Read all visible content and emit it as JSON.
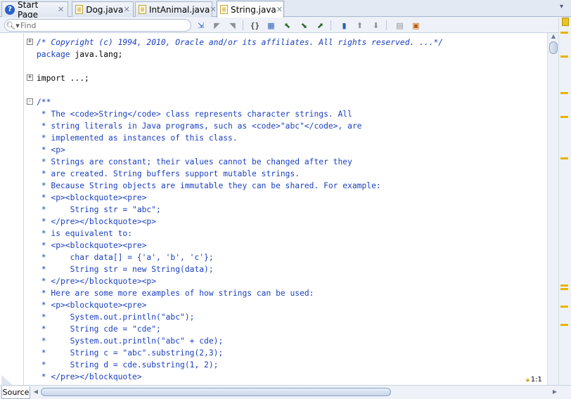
{
  "tabs": [
    {
      "label": "Start Page",
      "icon": "help-icon",
      "close": "✕",
      "active": false
    },
    {
      "label": "Dog.java",
      "icon": "java-file-icon",
      "close": "✕",
      "active": false
    },
    {
      "label": "IntAnimal.java",
      "icon": "java-file-icon",
      "close": "✕",
      "active": false
    },
    {
      "label": "String.java",
      "icon": "java-file-icon",
      "close": "✕",
      "active": true
    }
  ],
  "tabbar_menu": "▾",
  "find": {
    "placeholder": "Find"
  },
  "toolbar_icons": [
    "last-edit-icon",
    "back-icon",
    "forward-icon",
    "toggle-bookmark-icon",
    "find-selection-icon",
    "find-previous-icon",
    "find-next-icon",
    "toggle-highlight-icon",
    "toggle-rectangular-selection-icon",
    "previous-bookmark-icon",
    "next-bookmark-icon",
    "start-macro-icon",
    "stop-macro-icon",
    "shift-left-icon",
    "shift-right-icon"
  ],
  "code_lines": [
    {
      "fold": "+",
      "text": "/* Copyright (c) 1994, 2010, Oracle and/or its affiliates. All rights reserved. ...*/",
      "style": "italic"
    },
    {
      "fold": "",
      "text": "package java.lang;",
      "style": "package"
    },
    {
      "fold": "",
      "text": "",
      "style": "black"
    },
    {
      "fold": "+",
      "text": "import ...;",
      "style": "black"
    },
    {
      "fold": "",
      "text": "",
      "style": "black"
    },
    {
      "fold": "-",
      "text": "/**",
      "style": "comment"
    },
    {
      "fold": "",
      "text": " * The <code>String</code> class represents character strings. All",
      "style": "comment"
    },
    {
      "fold": "",
      "text": " * string literals in Java programs, such as <code>\"abc\"</code>, are",
      "style": "comment"
    },
    {
      "fold": "",
      "text": " * implemented as instances of this class.",
      "style": "comment"
    },
    {
      "fold": "",
      "text": " * <p>",
      "style": "comment"
    },
    {
      "fold": "",
      "text": " * Strings are constant; their values cannot be changed after they",
      "style": "comment"
    },
    {
      "fold": "",
      "text": " * are created. String buffers support mutable strings.",
      "style": "comment"
    },
    {
      "fold": "",
      "text": " * Because String objects are immutable they can be shared. For example:",
      "style": "comment"
    },
    {
      "fold": "",
      "text": " * <p><blockquote><pre>",
      "style": "comment"
    },
    {
      "fold": "",
      "text": " *     String str = \"abc\";",
      "style": "comment"
    },
    {
      "fold": "",
      "text": " * </pre></blockquote><p>",
      "style": "comment"
    },
    {
      "fold": "",
      "text": " * is equivalent to:",
      "style": "comment"
    },
    {
      "fold": "",
      "text": " * <p><blockquote><pre>",
      "style": "comment"
    },
    {
      "fold": "",
      "text": " *     char data[] = {'a', 'b', 'c'};",
      "style": "comment"
    },
    {
      "fold": "",
      "text": " *     String str = new String(data);",
      "style": "comment"
    },
    {
      "fold": "",
      "text": " * </pre></blockquote><p>",
      "style": "comment"
    },
    {
      "fold": "",
      "text": " * Here are some more examples of how strings can be used:",
      "style": "comment"
    },
    {
      "fold": "",
      "text": " * <p><blockquote><pre>",
      "style": "comment"
    },
    {
      "fold": "",
      "text": " *     System.out.println(\"abc\");",
      "style": "comment"
    },
    {
      "fold": "",
      "text": " *     String cde = \"cde\";",
      "style": "comment"
    },
    {
      "fold": "",
      "text": " *     System.out.println(\"abc\" + cde);",
      "style": "comment"
    },
    {
      "fold": "",
      "text": " *     String c = \"abc\".substring(2,3);",
      "style": "comment"
    },
    {
      "fold": "",
      "text": " *     String d = cde.substring(1, 2);",
      "style": "comment"
    },
    {
      "fold": "",
      "text": " * </pre></blockquote>",
      "style": "comment"
    }
  ],
  "status": {
    "lock_icon": "lock-icon",
    "position": "1:1"
  },
  "source_tab": "Source",
  "colors": {
    "comment": "#1a3fbf",
    "keyword": "#1a3fbf",
    "marker": "#e8b400",
    "active_tab": "#ffffff"
  }
}
